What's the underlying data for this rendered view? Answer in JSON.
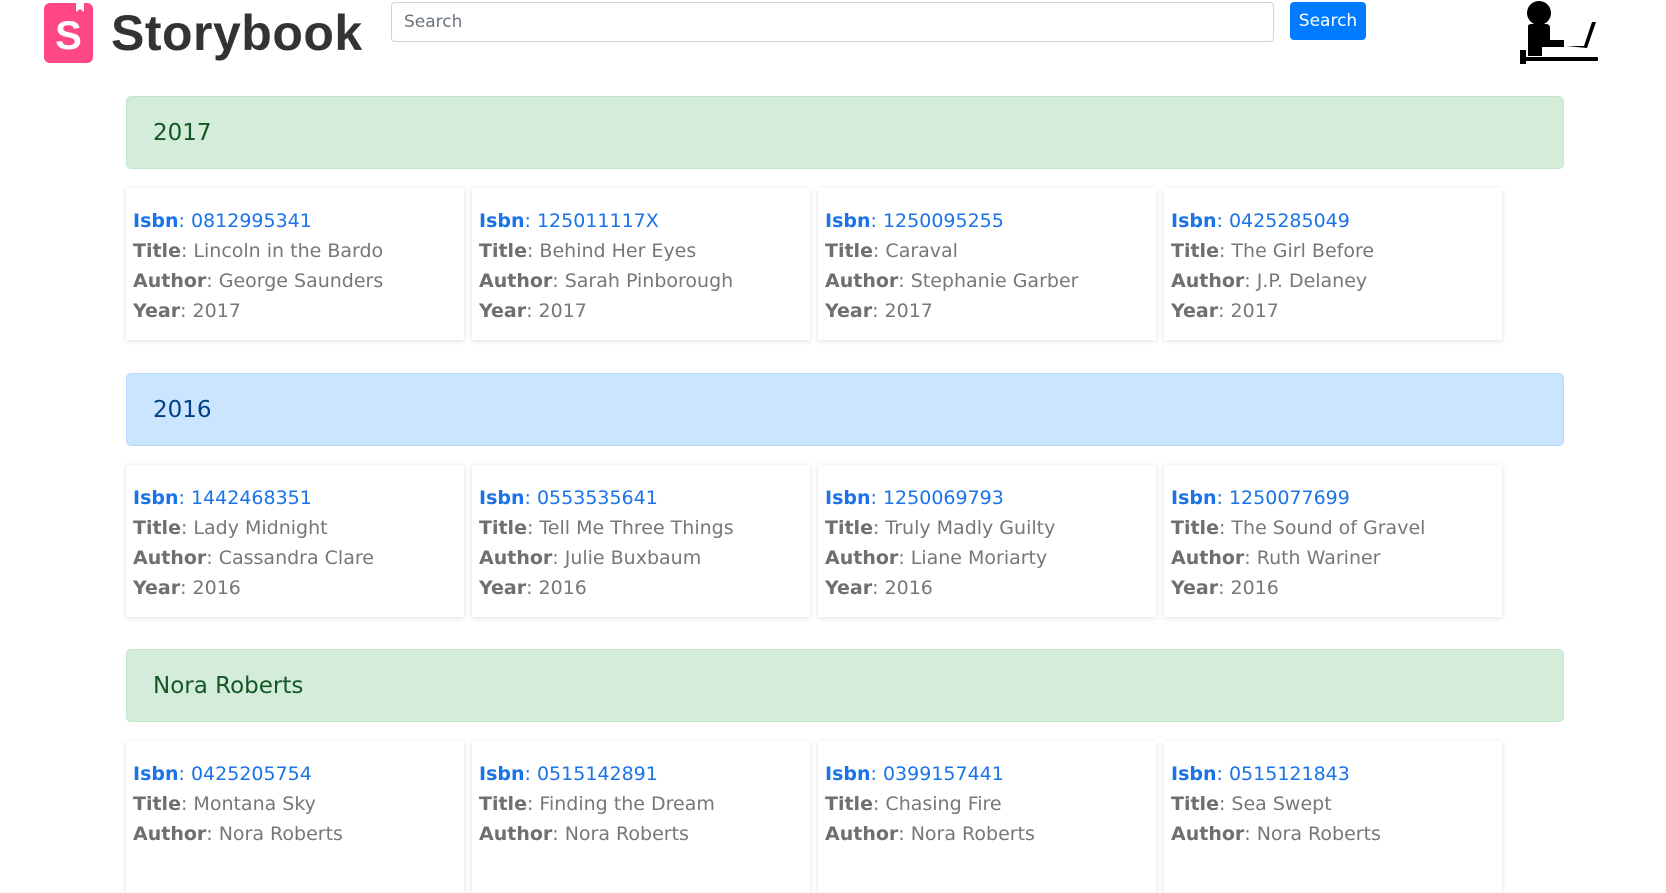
{
  "header": {
    "logo_letter": "S",
    "logo_text": "Storybook",
    "search_placeholder": "Search",
    "search_button": "Search"
  },
  "labels": {
    "isbn": "Isbn",
    "title": "Title",
    "author": "Author",
    "year": "Year"
  },
  "sections": [
    {
      "heading": "2017",
      "style": "green",
      "books": [
        {
          "isbn": "0812995341",
          "title": "Lincoln in the Bardo",
          "author": "George Saunders",
          "year": "2017"
        },
        {
          "isbn": "125011117X",
          "title": "Behind Her Eyes",
          "author": "Sarah Pinborough",
          "year": "2017"
        },
        {
          "isbn": "1250095255",
          "title": "Caraval",
          "author": "Stephanie Garber",
          "year": "2017"
        },
        {
          "isbn": "0425285049",
          "title": "The Girl Before",
          "author": "J.P. Delaney",
          "year": "2017"
        }
      ]
    },
    {
      "heading": "2016",
      "style": "blue",
      "books": [
        {
          "isbn": "1442468351",
          "title": "Lady Midnight",
          "author": "Cassandra Clare",
          "year": "2016"
        },
        {
          "isbn": "0553535641",
          "title": "Tell Me Three Things",
          "author": "Julie Buxbaum",
          "year": "2016"
        },
        {
          "isbn": "1250069793",
          "title": "Truly Madly Guilty",
          "author": "Liane Moriarty",
          "year": "2016"
        },
        {
          "isbn": "1250077699",
          "title": "The Sound of Gravel",
          "author": "Ruth Wariner",
          "year": "2016"
        }
      ]
    },
    {
      "heading": "Nora Roberts",
      "style": "green",
      "books": [
        {
          "isbn": "0425205754",
          "title": "Montana Sky",
          "author": "Nora Roberts"
        },
        {
          "isbn": "0515142891",
          "title": "Finding the Dream",
          "author": "Nora Roberts"
        },
        {
          "isbn": "0399157441",
          "title": "Chasing Fire",
          "author": "Nora Roberts"
        },
        {
          "isbn": "0515121843",
          "title": "Sea Swept",
          "author": "Nora Roberts"
        }
      ]
    }
  ],
  "colors": {
    "brand": "#ff4785",
    "primary": "#007bff",
    "isbn_link": "#1a73e8",
    "section_green_bg": "#d4edda",
    "section_blue_bg": "#cce5ff"
  },
  "icons": {
    "user": "person-at-laptop-icon"
  }
}
